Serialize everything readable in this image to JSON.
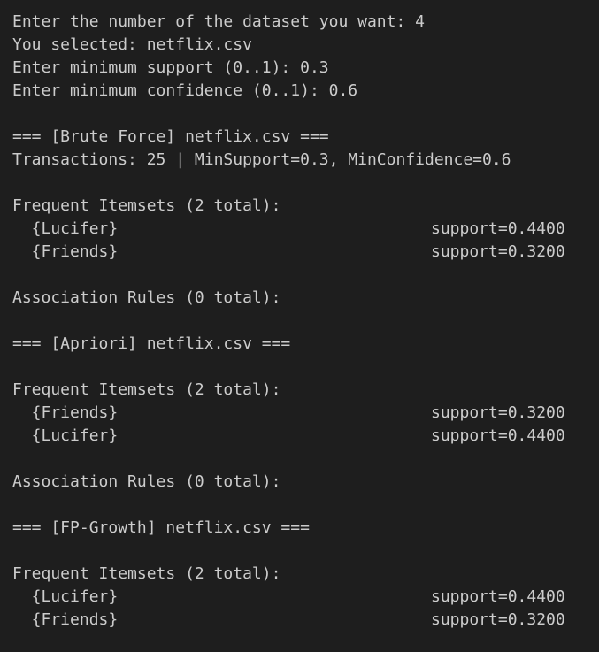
{
  "prompt": {
    "dataset_prompt": "Enter the number of the dataset you want: 4",
    "selected": "You selected: netflix.csv",
    "min_support": "Enter minimum support (0..1): 0.3",
    "min_confidence": "Enter minimum confidence (0..1): 0.6"
  },
  "brute_force": {
    "header": "=== [Brute Force] netflix.csv ===",
    "transactions": "Transactions: 25 | MinSupport=0.3, MinConfidence=0.6",
    "itemsets_title": "Frequent Itemsets (2 total):",
    "itemsets": [
      {
        "item": "{Lucifer}",
        "support": "support=0.4400"
      },
      {
        "item": "{Friends}",
        "support": "support=0.3200"
      }
    ],
    "rules_title": "Association Rules (0 total):"
  },
  "apriori": {
    "header": "=== [Apriori] netflix.csv ===",
    "itemsets_title": "Frequent Itemsets (2 total):",
    "itemsets": [
      {
        "item": "{Friends}",
        "support": "support=0.3200"
      },
      {
        "item": "{Lucifer}",
        "support": "support=0.4400"
      }
    ],
    "rules_title": "Association Rules (0 total):"
  },
  "fp_growth": {
    "header": "=== [FP-Growth] netflix.csv ===",
    "itemsets_title": "Frequent Itemsets (2 total):",
    "itemsets": [
      {
        "item": "{Lucifer}",
        "support": "support=0.4400"
      },
      {
        "item": "{Friends}",
        "support": "support=0.3200"
      }
    ]
  }
}
